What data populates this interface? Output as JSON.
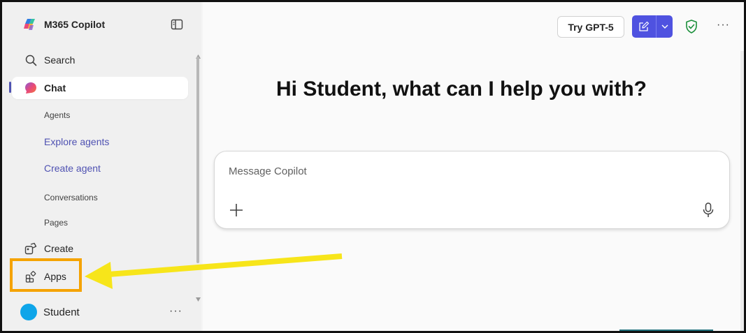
{
  "app": {
    "title": "M365 Copilot"
  },
  "sidebar": {
    "search_label": "Search",
    "chat_label": "Chat",
    "agents_label": "Agents",
    "explore_agents": "Explore agents",
    "create_agent": "Create agent",
    "conversations_label": "Conversations",
    "pages_label": "Pages",
    "create_label": "Create",
    "apps_label": "Apps",
    "user_name": "Student",
    "user_more": "···"
  },
  "header": {
    "try_button": "Try GPT-5",
    "more": "···"
  },
  "main": {
    "greeting": "Hi Student, what can I help you with?",
    "composer_placeholder": "Message Copilot"
  },
  "colors": {
    "accent": "#4f52e0",
    "link": "#4f52b2",
    "highlight_box": "#f5a300",
    "arrow": "#f7e51a",
    "avatar": "#0ea5e9",
    "shield": "#1a8f3a"
  },
  "icons": [
    "copilot-logo-icon",
    "sidebar-toggle-icon",
    "search-icon",
    "chat-icon",
    "create-icon",
    "apps-icon",
    "new-chat-icon",
    "chevron-down-icon",
    "shield-check-icon",
    "plus-icon",
    "microphone-icon"
  ]
}
